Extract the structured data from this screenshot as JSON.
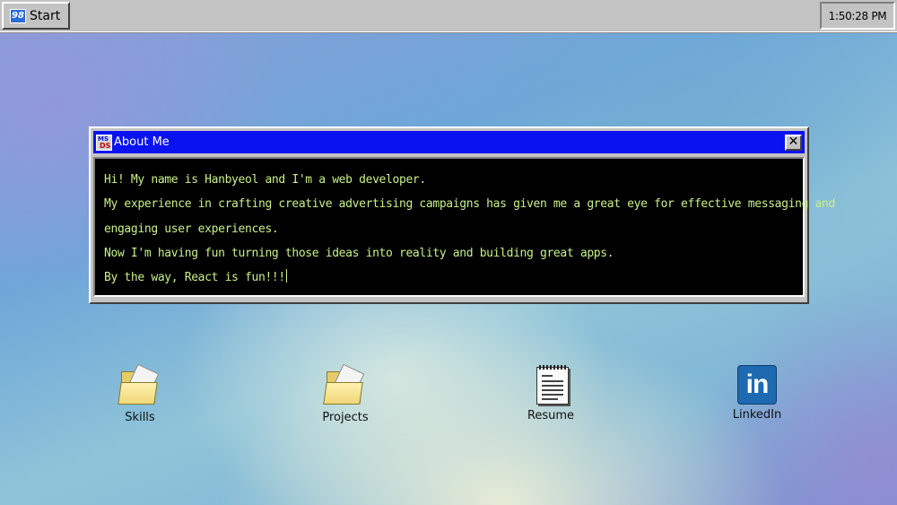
{
  "taskbar": {
    "start_label": "Start",
    "start_logo": "98",
    "clock": "1:50:28 PM"
  },
  "window": {
    "title": "About Me",
    "icon_text_top": "MS",
    "icon_text_bottom": "DS",
    "close_glyph": "✕",
    "lines": [
      "Hi! My name is Hanbyeol and I'm a web developer.",
      "My experience in crafting creative advertising campaigns has given me a great eye for effective messaging and",
      "engaging user experiences.",
      "Now I'm having fun turning those ideas into reality and building great apps.",
      "By the way, React is fun!!!"
    ]
  },
  "desktop_icons": [
    {
      "label": "Skills",
      "icon": "folder-icon"
    },
    {
      "label": "Projects",
      "icon": "folder-icon"
    },
    {
      "label": "Resume",
      "icon": "document-icon"
    },
    {
      "label": "LinkedIn",
      "icon": "linkedin-icon",
      "glyph": "in"
    }
  ],
  "colors": {
    "titlebar": "#0a12f0",
    "terminal_text": "#c7f08a",
    "terminal_bg": "#000000",
    "chrome": "#c3c3c3"
  }
}
